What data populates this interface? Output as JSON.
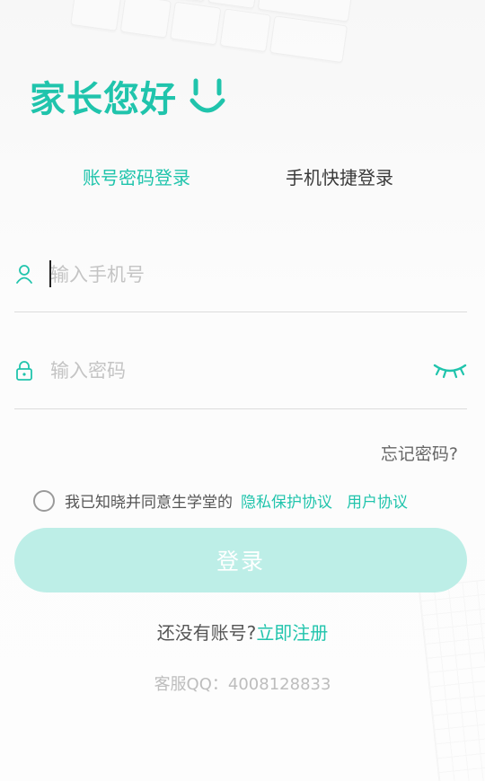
{
  "greeting": {
    "title": "家长您好",
    "icon": "smile-icon"
  },
  "tabs": [
    {
      "label": "账号密码登录",
      "active": true
    },
    {
      "label": "手机快捷登录",
      "active": false
    }
  ],
  "form": {
    "phone": {
      "placeholder": "输入手机号",
      "value": "",
      "icon": "user-icon"
    },
    "password": {
      "placeholder": "输入密码",
      "value": "",
      "icon": "lock-icon",
      "toggle_icon": "eye-closed-icon"
    },
    "forgot_label": "忘记密码?"
  },
  "agreement": {
    "checked": false,
    "text": "我已知晓并同意生学堂的",
    "privacy_label": "隐私保护协议",
    "user_label": "用户协议"
  },
  "login_button_label": "登录",
  "register": {
    "question": "还没有账号?",
    "link_label": "立即注册"
  },
  "service_text": "客服QQ：4008128833",
  "colors": {
    "accent": "#20c4ac",
    "button_disabled": "#bdeee7"
  }
}
